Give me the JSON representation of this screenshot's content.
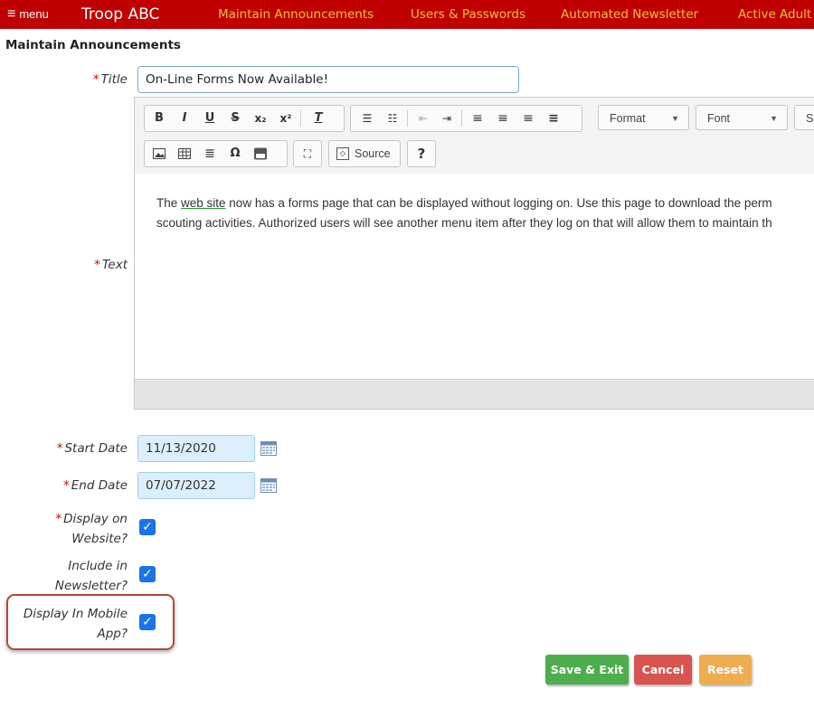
{
  "nav": {
    "menu_label": "menu",
    "brand": "Troop ABC",
    "links": [
      "Maintain Announcements",
      "Users & Passwords",
      "Automated Newsletter",
      "Active Adult"
    ]
  },
  "page_title": "Maintain Announcements",
  "form": {
    "title_label": "Title",
    "title_value": "On-Line Forms Now Available!",
    "text_label": "Text",
    "start_date_label": "Start Date",
    "start_date_value": "11/13/2020",
    "end_date_label": "End Date",
    "end_date_value": "07/07/2022",
    "display_website_label_1": "Display on",
    "display_website_label_2": "Website?",
    "display_website_checked": true,
    "newsletter_label_1": "Include in",
    "newsletter_label_2": "Newsletter?",
    "newsletter_checked": true,
    "mobile_label_1": "Display In Mobile",
    "mobile_label_2": "App?",
    "mobile_checked": true,
    "required_marker": "*"
  },
  "editor": {
    "format_label": "Format",
    "font_label": "Font",
    "size_label": "Si",
    "source_label": "Source",
    "help_label": "?",
    "content_line1_pre": "The ",
    "content_link": "web site",
    "content_line1_post": " now has a forms page that can be displayed without logging on. Use this page to download the perm",
    "content_line2": "scouting activities. Authorized users will see another menu item after they log on that will allow them to maintain th"
  },
  "buttons": {
    "save": "Save & Exit",
    "cancel": "Cancel",
    "reset": "Reset"
  },
  "colors": {
    "nav_bg": "#c00000",
    "nav_link": "#f3c03c",
    "save": "#4cae4c",
    "cancel": "#d9534f",
    "reset": "#f0ad4e",
    "checkbox": "#1a73e8",
    "required": "#d40000"
  }
}
